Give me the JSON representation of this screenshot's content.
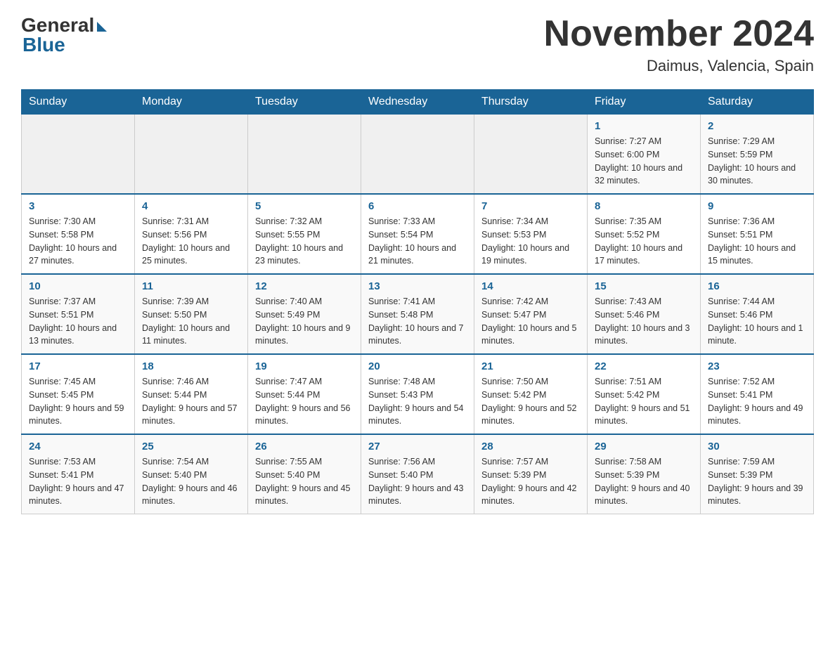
{
  "header": {
    "logo_general": "General",
    "logo_blue": "Blue",
    "month_title": "November 2024",
    "location": "Daimus, Valencia, Spain"
  },
  "days_of_week": [
    "Sunday",
    "Monday",
    "Tuesday",
    "Wednesday",
    "Thursday",
    "Friday",
    "Saturday"
  ],
  "weeks": [
    [
      {
        "day": "",
        "sunrise": "",
        "sunset": "",
        "daylight": ""
      },
      {
        "day": "",
        "sunrise": "",
        "sunset": "",
        "daylight": ""
      },
      {
        "day": "",
        "sunrise": "",
        "sunset": "",
        "daylight": ""
      },
      {
        "day": "",
        "sunrise": "",
        "sunset": "",
        "daylight": ""
      },
      {
        "day": "",
        "sunrise": "",
        "sunset": "",
        "daylight": ""
      },
      {
        "day": "1",
        "sunrise": "Sunrise: 7:27 AM",
        "sunset": "Sunset: 6:00 PM",
        "daylight": "Daylight: 10 hours and 32 minutes."
      },
      {
        "day": "2",
        "sunrise": "Sunrise: 7:29 AM",
        "sunset": "Sunset: 5:59 PM",
        "daylight": "Daylight: 10 hours and 30 minutes."
      }
    ],
    [
      {
        "day": "3",
        "sunrise": "Sunrise: 7:30 AM",
        "sunset": "Sunset: 5:58 PM",
        "daylight": "Daylight: 10 hours and 27 minutes."
      },
      {
        "day": "4",
        "sunrise": "Sunrise: 7:31 AM",
        "sunset": "Sunset: 5:56 PM",
        "daylight": "Daylight: 10 hours and 25 minutes."
      },
      {
        "day": "5",
        "sunrise": "Sunrise: 7:32 AM",
        "sunset": "Sunset: 5:55 PM",
        "daylight": "Daylight: 10 hours and 23 minutes."
      },
      {
        "day": "6",
        "sunrise": "Sunrise: 7:33 AM",
        "sunset": "Sunset: 5:54 PM",
        "daylight": "Daylight: 10 hours and 21 minutes."
      },
      {
        "day": "7",
        "sunrise": "Sunrise: 7:34 AM",
        "sunset": "Sunset: 5:53 PM",
        "daylight": "Daylight: 10 hours and 19 minutes."
      },
      {
        "day": "8",
        "sunrise": "Sunrise: 7:35 AM",
        "sunset": "Sunset: 5:52 PM",
        "daylight": "Daylight: 10 hours and 17 minutes."
      },
      {
        "day": "9",
        "sunrise": "Sunrise: 7:36 AM",
        "sunset": "Sunset: 5:51 PM",
        "daylight": "Daylight: 10 hours and 15 minutes."
      }
    ],
    [
      {
        "day": "10",
        "sunrise": "Sunrise: 7:37 AM",
        "sunset": "Sunset: 5:51 PM",
        "daylight": "Daylight: 10 hours and 13 minutes."
      },
      {
        "day": "11",
        "sunrise": "Sunrise: 7:39 AM",
        "sunset": "Sunset: 5:50 PM",
        "daylight": "Daylight: 10 hours and 11 minutes."
      },
      {
        "day": "12",
        "sunrise": "Sunrise: 7:40 AM",
        "sunset": "Sunset: 5:49 PM",
        "daylight": "Daylight: 10 hours and 9 minutes."
      },
      {
        "day": "13",
        "sunrise": "Sunrise: 7:41 AM",
        "sunset": "Sunset: 5:48 PM",
        "daylight": "Daylight: 10 hours and 7 minutes."
      },
      {
        "day": "14",
        "sunrise": "Sunrise: 7:42 AM",
        "sunset": "Sunset: 5:47 PM",
        "daylight": "Daylight: 10 hours and 5 minutes."
      },
      {
        "day": "15",
        "sunrise": "Sunrise: 7:43 AM",
        "sunset": "Sunset: 5:46 PM",
        "daylight": "Daylight: 10 hours and 3 minutes."
      },
      {
        "day": "16",
        "sunrise": "Sunrise: 7:44 AM",
        "sunset": "Sunset: 5:46 PM",
        "daylight": "Daylight: 10 hours and 1 minute."
      }
    ],
    [
      {
        "day": "17",
        "sunrise": "Sunrise: 7:45 AM",
        "sunset": "Sunset: 5:45 PM",
        "daylight": "Daylight: 9 hours and 59 minutes."
      },
      {
        "day": "18",
        "sunrise": "Sunrise: 7:46 AM",
        "sunset": "Sunset: 5:44 PM",
        "daylight": "Daylight: 9 hours and 57 minutes."
      },
      {
        "day": "19",
        "sunrise": "Sunrise: 7:47 AM",
        "sunset": "Sunset: 5:44 PM",
        "daylight": "Daylight: 9 hours and 56 minutes."
      },
      {
        "day": "20",
        "sunrise": "Sunrise: 7:48 AM",
        "sunset": "Sunset: 5:43 PM",
        "daylight": "Daylight: 9 hours and 54 minutes."
      },
      {
        "day": "21",
        "sunrise": "Sunrise: 7:50 AM",
        "sunset": "Sunset: 5:42 PM",
        "daylight": "Daylight: 9 hours and 52 minutes."
      },
      {
        "day": "22",
        "sunrise": "Sunrise: 7:51 AM",
        "sunset": "Sunset: 5:42 PM",
        "daylight": "Daylight: 9 hours and 51 minutes."
      },
      {
        "day": "23",
        "sunrise": "Sunrise: 7:52 AM",
        "sunset": "Sunset: 5:41 PM",
        "daylight": "Daylight: 9 hours and 49 minutes."
      }
    ],
    [
      {
        "day": "24",
        "sunrise": "Sunrise: 7:53 AM",
        "sunset": "Sunset: 5:41 PM",
        "daylight": "Daylight: 9 hours and 47 minutes."
      },
      {
        "day": "25",
        "sunrise": "Sunrise: 7:54 AM",
        "sunset": "Sunset: 5:40 PM",
        "daylight": "Daylight: 9 hours and 46 minutes."
      },
      {
        "day": "26",
        "sunrise": "Sunrise: 7:55 AM",
        "sunset": "Sunset: 5:40 PM",
        "daylight": "Daylight: 9 hours and 45 minutes."
      },
      {
        "day": "27",
        "sunrise": "Sunrise: 7:56 AM",
        "sunset": "Sunset: 5:40 PM",
        "daylight": "Daylight: 9 hours and 43 minutes."
      },
      {
        "day": "28",
        "sunrise": "Sunrise: 7:57 AM",
        "sunset": "Sunset: 5:39 PM",
        "daylight": "Daylight: 9 hours and 42 minutes."
      },
      {
        "day": "29",
        "sunrise": "Sunrise: 7:58 AM",
        "sunset": "Sunset: 5:39 PM",
        "daylight": "Daylight: 9 hours and 40 minutes."
      },
      {
        "day": "30",
        "sunrise": "Sunrise: 7:59 AM",
        "sunset": "Sunset: 5:39 PM",
        "daylight": "Daylight: 9 hours and 39 minutes."
      }
    ]
  ]
}
